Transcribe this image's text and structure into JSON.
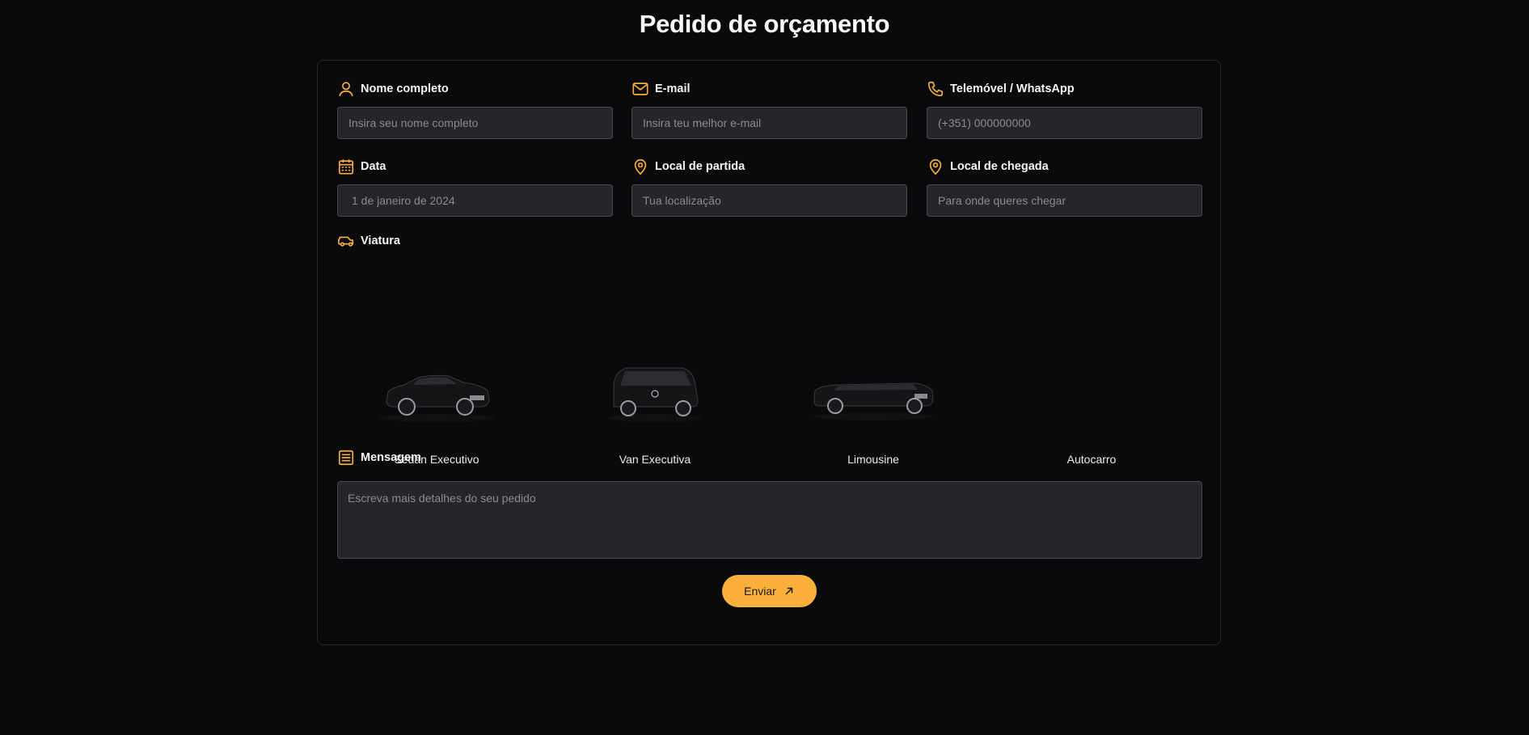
{
  "page": {
    "title": "Pedido de orçamento"
  },
  "colors": {
    "accent": "#fbb03b",
    "background": "#0a0a0c",
    "input_bg": "#26262a"
  },
  "form": {
    "name": {
      "label": "Nome completo",
      "placeholder": "Insira seu nome completo",
      "icon": "user-icon"
    },
    "email": {
      "label": "E-mail",
      "placeholder": "Insira teu melhor e-mail",
      "icon": "mail-icon"
    },
    "phone": {
      "label": "Telemóvel / WhatsApp",
      "placeholder": "(+351) 000000000",
      "icon": "phone-icon"
    },
    "date": {
      "label": "Data",
      "value": "1 de janeiro de 2024",
      "icon": "calendar-icon"
    },
    "departure": {
      "label": "Local de partida",
      "placeholder": "Tua localização",
      "icon": "map-pin-icon"
    },
    "arrival": {
      "label": "Local de chegada",
      "placeholder": "Para onde queres chegar",
      "icon": "map-pin-icon"
    },
    "vehicle": {
      "label": "Viatura",
      "icon": "car-icon",
      "options": [
        {
          "name": "Sedan Executivo",
          "image": "sedan"
        },
        {
          "name": "Van Executiva",
          "image": "van"
        },
        {
          "name": "Limousine",
          "image": "limousine"
        },
        {
          "name": "Autocarro",
          "image": "none"
        }
      ]
    },
    "message": {
      "label": "Mensagem",
      "placeholder": "Escreva mais detalhes do seu pedido",
      "icon": "text-icon"
    },
    "submit": {
      "label": "Enviar",
      "icon": "arrow-up-right-icon"
    }
  }
}
